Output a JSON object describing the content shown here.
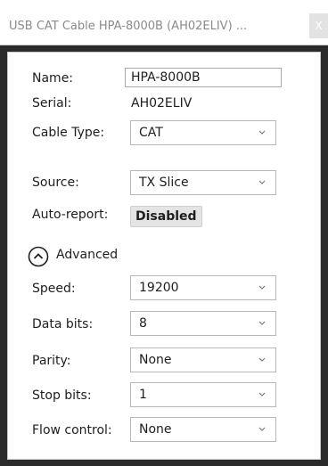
{
  "window": {
    "title": "USB CAT Cable HPA-8000B (AH02ELIV) ...",
    "close_label": "X"
  },
  "form": {
    "name_label": "Name:",
    "name_value": "HPA-8000B",
    "serial_label": "Serial:",
    "serial_value": "AH02ELIV",
    "cable_type_label": "Cable Type:",
    "cable_type_value": "CAT",
    "source_label": "Source:",
    "source_value": "TX Slice",
    "auto_report_label": "Auto-report:",
    "auto_report_value": "Disabled"
  },
  "advanced": {
    "toggle_label": "Advanced",
    "speed_label": "Speed:",
    "speed_value": "19200",
    "data_bits_label": "Data bits:",
    "data_bits_value": "8",
    "parity_label": "Parity:",
    "parity_value": "None",
    "stop_bits_label": "Stop bits:",
    "stop_bits_value": "1",
    "flow_control_label": "Flow control:",
    "flow_control_value": "None"
  },
  "icons": {
    "close": "close-icon",
    "chevron": "chevron-down-icon",
    "collapse": "chevron-up-circle-icon"
  }
}
